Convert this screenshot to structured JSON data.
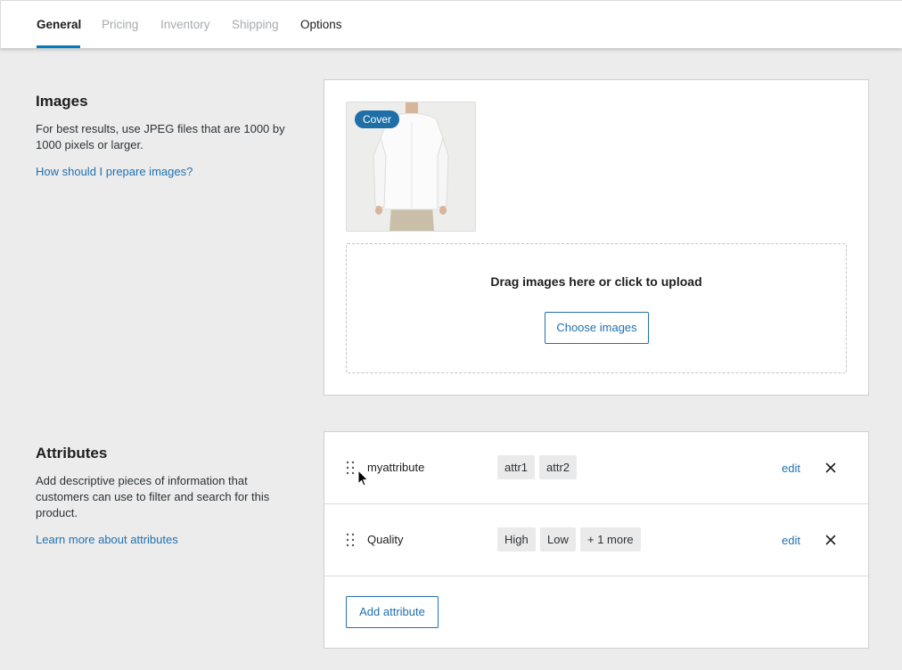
{
  "tabs": [
    {
      "label": "General",
      "state": "active"
    },
    {
      "label": "Pricing",
      "state": "disabled"
    },
    {
      "label": "Inventory",
      "state": "disabled"
    },
    {
      "label": "Shipping",
      "state": "disabled"
    },
    {
      "label": "Options",
      "state": "enabled"
    }
  ],
  "images_section": {
    "title": "Images",
    "description": "For best results, use JPEG files that are 1000 by 1000 pixels or larger.",
    "help_link": "How should I prepare images?",
    "thumbnail_badge": "Cover",
    "dropzone_text": "Drag images here or click to upload",
    "choose_button": "Choose images"
  },
  "attributes_section": {
    "title": "Attributes",
    "description": "Add descriptive pieces of information that customers can use to filter and search for this product.",
    "help_link": "Learn more about attributes",
    "rows": [
      {
        "name": "myattribute",
        "values": [
          "attr1",
          "attr2"
        ],
        "edit_label": "edit"
      },
      {
        "name": "Quality",
        "values": [
          "High",
          "Low",
          "+ 1 more"
        ],
        "edit_label": "edit"
      }
    ],
    "add_button": "Add attribute"
  },
  "colors": {
    "accent": "#2271b1",
    "tab_underline": "#007cba",
    "badge": "#1e6fa8"
  }
}
